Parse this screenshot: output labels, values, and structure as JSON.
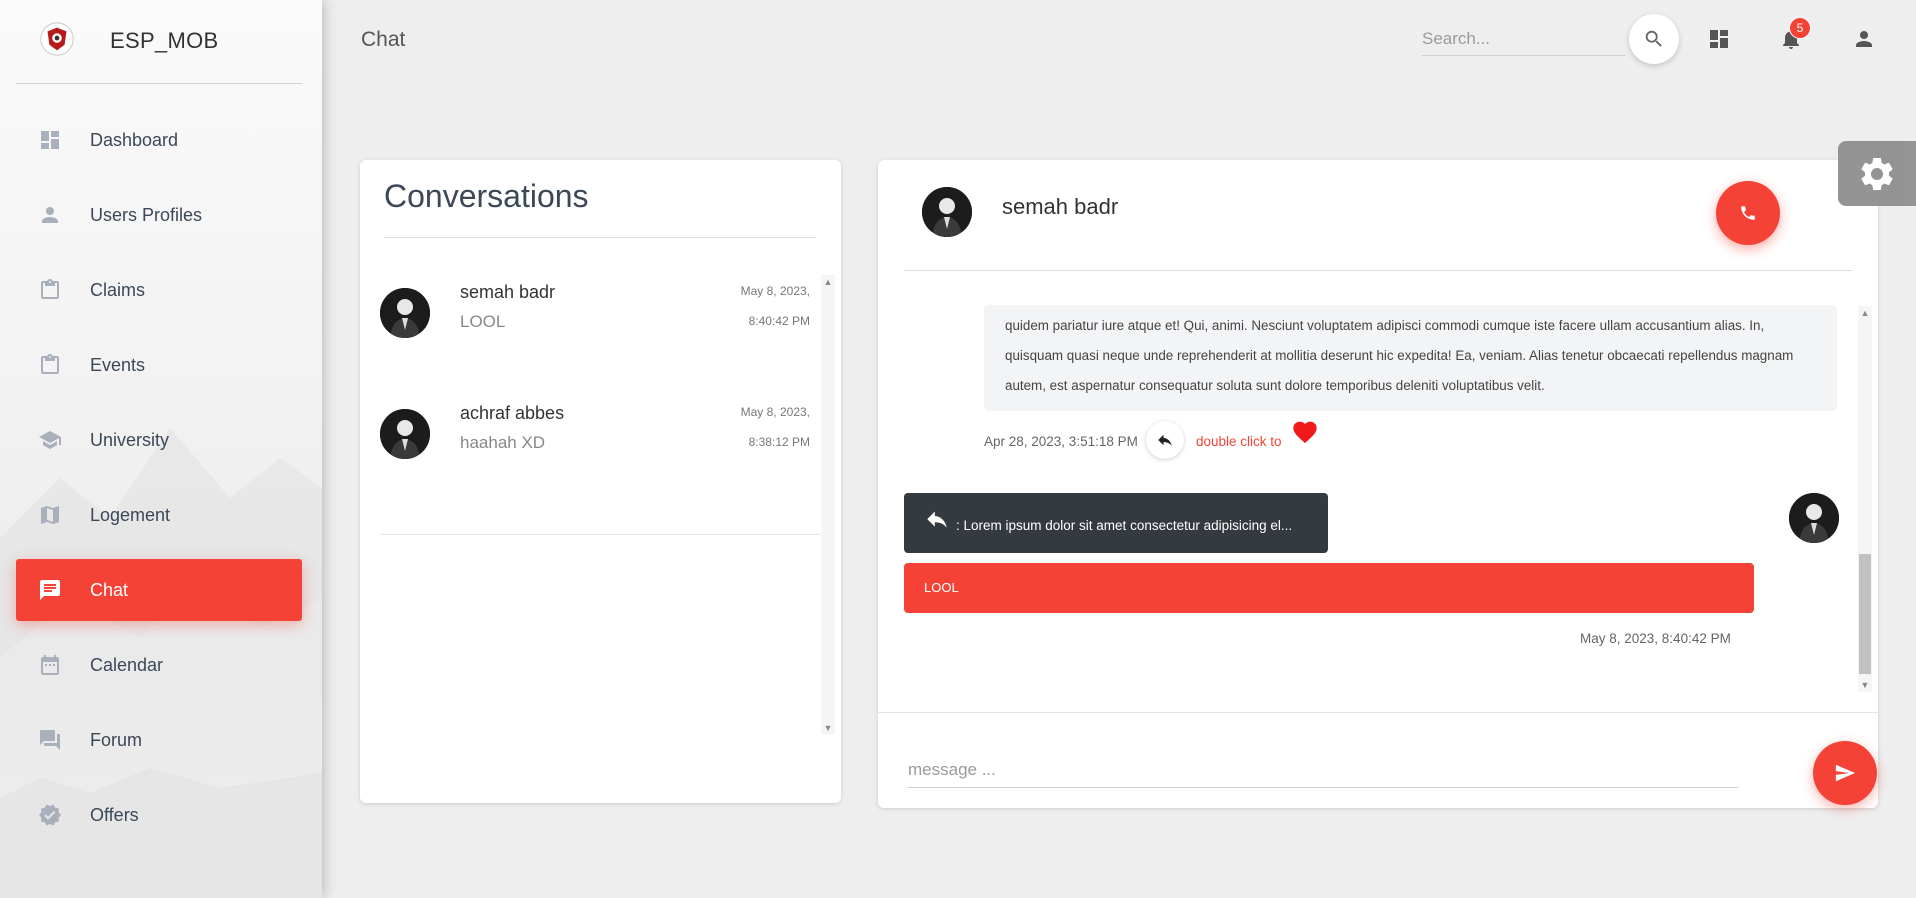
{
  "app": {
    "name": "ESP_MOB"
  },
  "sidebar": {
    "items": [
      {
        "label": "Dashboard",
        "icon": "dashboard-icon"
      },
      {
        "label": "Users Profiles",
        "icon": "person-icon"
      },
      {
        "label": "Claims",
        "icon": "clipboard-icon"
      },
      {
        "label": "Events",
        "icon": "clipboard-icon"
      },
      {
        "label": "University",
        "icon": "school-icon"
      },
      {
        "label": "Logement",
        "icon": "map-icon"
      },
      {
        "label": "Chat",
        "icon": "chat-icon",
        "active": true
      },
      {
        "label": "Calendar",
        "icon": "calendar-icon"
      },
      {
        "label": "Forum",
        "icon": "forum-icon"
      },
      {
        "label": "Offers",
        "icon": "verified-badge-icon"
      }
    ]
  },
  "header": {
    "title": "Chat",
    "search_placeholder": "Search...",
    "notification_count": "5"
  },
  "conversations": {
    "title": "Conversations",
    "items": [
      {
        "name": "semah badr",
        "last_message": "LOOL",
        "date": "May 8, 2023,",
        "time": "8:40:42 PM"
      },
      {
        "name": "achraf abbes",
        "last_message": "haahah XD",
        "date": "May 8, 2023,",
        "time": "8:38:12 PM"
      }
    ]
  },
  "chat": {
    "contact_name": "semah badr",
    "messages": {
      "received_text": "quidem pariatur iure atque et! Qui, animi. Nesciunt voluptatem adipisci commodi cumque iste facere ullam accusantium alias. In, quisquam quasi neque unde reprehenderit at mollitia deserunt hic expedita! Ea, veniam. Alias tenetur obcaecati repellendus magnam autem, est aspernatur consequatur soluta sunt dolore temporibus deleniti voluptatibus velit.",
      "received_time": "Apr 28, 2023, 3:51:18 PM",
      "double_click_hint": "double click to",
      "reply_quote": ": Lorem ipsum dolor sit amet consectetur adipisicing el...",
      "sent_text": "LOOL",
      "sent_time": "May 8, 2023, 8:40:42 PM"
    },
    "input_placeholder": "message ..."
  },
  "colors": {
    "accent": "#f44336",
    "dark": "#343a40",
    "sidebar_icon": "#a9afbb"
  }
}
